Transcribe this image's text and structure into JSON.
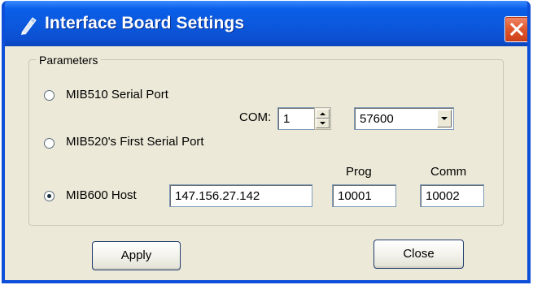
{
  "window": {
    "title": "Interface Board Settings",
    "title_icon": "pen-icon",
    "close_icon": "close-icon",
    "colors": {
      "titlebar": "#0b58dc",
      "close_button": "#e15a2f",
      "dialog_background": "#ece9d8"
    }
  },
  "parameters": {
    "legend": "Parameters",
    "options": [
      {
        "label": "MIB510 Serial Port",
        "selected": false
      },
      {
        "label": "MIB520's  First  Serial Port",
        "selected": false
      },
      {
        "label": "MIB600 Host",
        "selected": true
      }
    ],
    "com": {
      "label": "COM:",
      "value": "1"
    },
    "baud": {
      "selected": "57600"
    },
    "host": {
      "value": "147.156.27.142"
    },
    "prog": {
      "label": "Prog",
      "value": "10001"
    },
    "comm": {
      "label": "Comm",
      "value": "10002"
    }
  },
  "buttons": {
    "apply": "Apply",
    "close": "Close"
  }
}
